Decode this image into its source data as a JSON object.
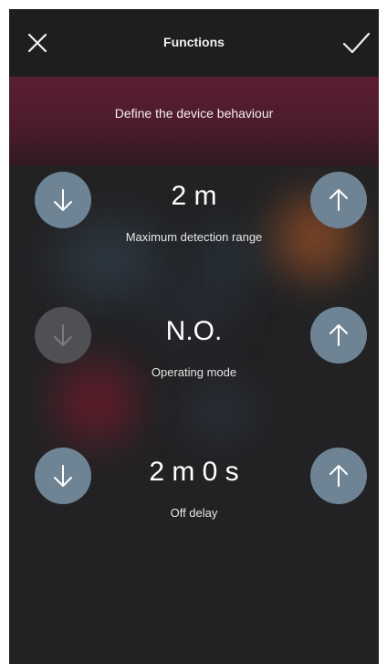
{
  "header": {
    "title": "Functions",
    "close_icon": "close-icon",
    "confirm_icon": "checkmark-icon"
  },
  "banner": {
    "subtitle": "Define the device behaviour"
  },
  "functions": [
    {
      "value": "2 m",
      "label": "Maximum detection range",
      "decrease_enabled": true,
      "increase_enabled": true
    },
    {
      "value": "N.O.",
      "label": "Operating mode",
      "decrease_enabled": false,
      "increase_enabled": true
    },
    {
      "value": "2 m 0 s",
      "label": "Off delay",
      "decrease_enabled": true,
      "increase_enabled": true
    }
  ],
  "colors": {
    "background": "#222224",
    "banner": "#5a1e34",
    "button": "#6e8494",
    "button_disabled": "#4e5054"
  }
}
